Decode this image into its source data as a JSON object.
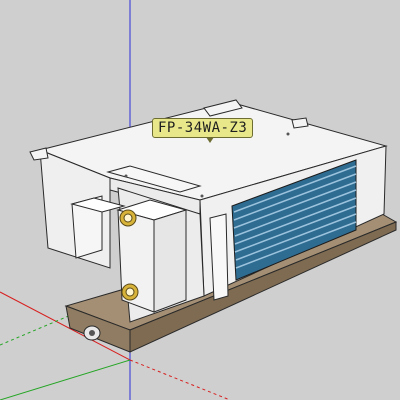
{
  "viewport": {
    "background_color": "#cfcfcf",
    "axis_colors": {
      "blue": "#2d2dd8",
      "red": "#d81f1f",
      "green": "#24a524"
    }
  },
  "model": {
    "tag_text": "FP-34WA-Z3",
    "tag_color": "#e8e88a",
    "body_color": "#f4f4f4",
    "coil_color": "#2f6c92",
    "drip_pan_color": "#a48f74",
    "pipe_fitting_color": "#d8b33a"
  }
}
